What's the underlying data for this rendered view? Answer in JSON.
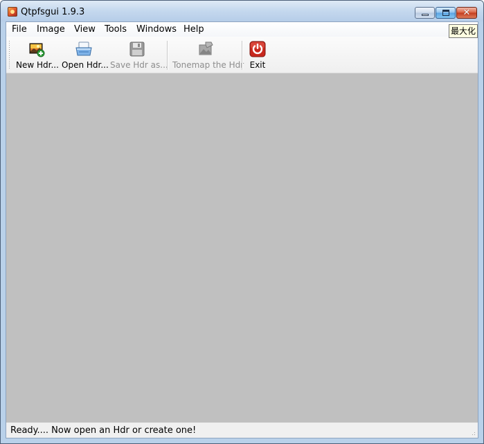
{
  "window": {
    "title": "Qtpfsgui 1.9.3",
    "tooltip": "最大化"
  },
  "menu": {
    "items": [
      "File",
      "Image",
      "View",
      "Tools",
      "Windows",
      "Help"
    ]
  },
  "toolbar": {
    "buttons": [
      {
        "label": "New Hdr...",
        "icon": "new-hdr-icon",
        "enabled": true
      },
      {
        "label": "Open Hdr...",
        "icon": "open-hdr-icon",
        "enabled": true
      },
      {
        "label": "Save Hdr as...",
        "icon": "save-icon",
        "enabled": false
      },
      {
        "label": "Tonemap the Hdr",
        "icon": "tonemap-icon",
        "enabled": false
      },
      {
        "label": "Exit",
        "icon": "exit-icon",
        "enabled": true
      }
    ]
  },
  "status": {
    "text": "Ready.... Now open an Hdr or create one!"
  },
  "colors": {
    "workspace": "#c0c0c0",
    "exit_red": "#c8281e"
  }
}
